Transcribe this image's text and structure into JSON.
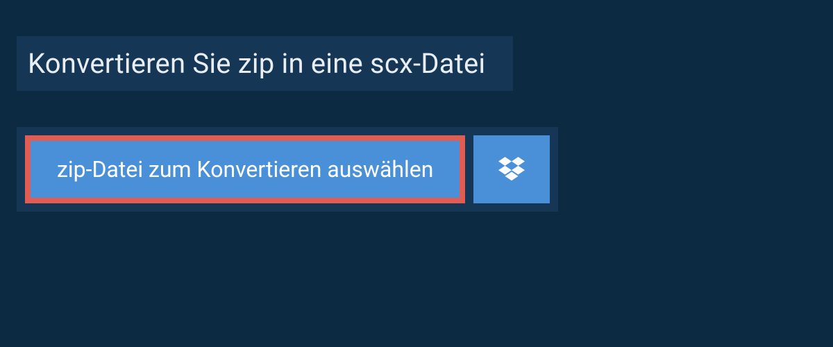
{
  "heading": "Konvertieren Sie zip in eine scx-Datei",
  "buttons": {
    "select_file_label": "zip-Datei zum Konvertieren auswählen"
  }
}
